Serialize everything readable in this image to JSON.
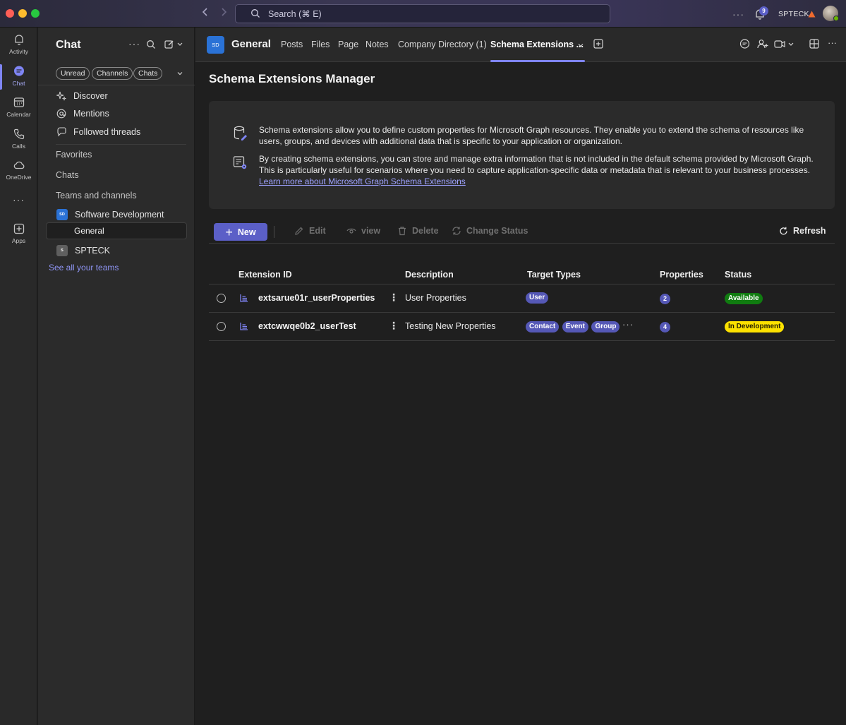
{
  "titlebar": {
    "search_placeholder": "Search (⌘ E)",
    "notification_count": "9",
    "user_name": "SPTECK"
  },
  "rail": {
    "items": [
      {
        "label": "Activity",
        "icon": "bell-icon"
      },
      {
        "label": "Chat",
        "icon": "chat-icon"
      },
      {
        "label": "Calendar",
        "icon": "calendar-icon"
      },
      {
        "label": "Calls",
        "icon": "phone-icon"
      },
      {
        "label": "OneDrive",
        "icon": "cloud-icon"
      },
      {
        "label": "Apps",
        "icon": "apps-plus-icon"
      }
    ]
  },
  "sidebar": {
    "title": "Chat",
    "filters": [
      "Unread",
      "Channels",
      "Chats"
    ],
    "quick": [
      "Discover",
      "Mentions",
      "Followed threads"
    ],
    "sections": {
      "favorites": "Favorites",
      "chats": "Chats",
      "teams": "Teams and channels"
    },
    "teams": [
      {
        "name": "Software Development",
        "initials": "SD",
        "color": "#2a72d6"
      },
      {
        "name": "SPTECK",
        "initials": "S",
        "color": "#5f5f5f"
      }
    ],
    "selected_channel": "General",
    "see_all": "See all your teams"
  },
  "header": {
    "team_initials": "SD",
    "channel": "General",
    "tabs": [
      "Posts",
      "Files",
      "Page",
      "Notes",
      "Company Directory (1)",
      "Schema Extensions ..."
    ],
    "active_tab": "Schema Extensions ..."
  },
  "page": {
    "title": "Schema Extensions Manager",
    "info_1": "Schema extensions allow you to define custom properties for Microsoft Graph resources. They enable you to extend the schema of resources like users, groups, and devices with additional data that is specific to your application or organization.",
    "info_2": "By creating schema extensions, you can store and manage extra information that is not included in the default schema provided by Microsoft Graph. This is particularly useful for scenarios where you need to capture application-specific data or metadata that is relevant to your business processes.",
    "info_link": "Learn more about Microsoft Graph Schema Extensions"
  },
  "toolbar": {
    "new": "New",
    "edit": "Edit",
    "view": "view",
    "delete": "Delete",
    "change_status": "Change Status",
    "refresh": "Refresh"
  },
  "table": {
    "columns": [
      "Extension ID",
      "Description",
      "Target Types",
      "Properties",
      "Status"
    ],
    "rows": [
      {
        "id": "extsarue01r_userProperties",
        "description": "User Properties",
        "targets": [
          "User"
        ],
        "properties": "2",
        "status": "Available"
      },
      {
        "id": "extcwwqe0b2_userTest",
        "description": "Testing New Properties",
        "targets": [
          "Contact",
          "Event",
          "Group"
        ],
        "properties": "4",
        "status": "In Development"
      }
    ]
  },
  "colors": {
    "accent": "#5b5fc7",
    "available": "#107c10",
    "in_development": "#fce100"
  }
}
